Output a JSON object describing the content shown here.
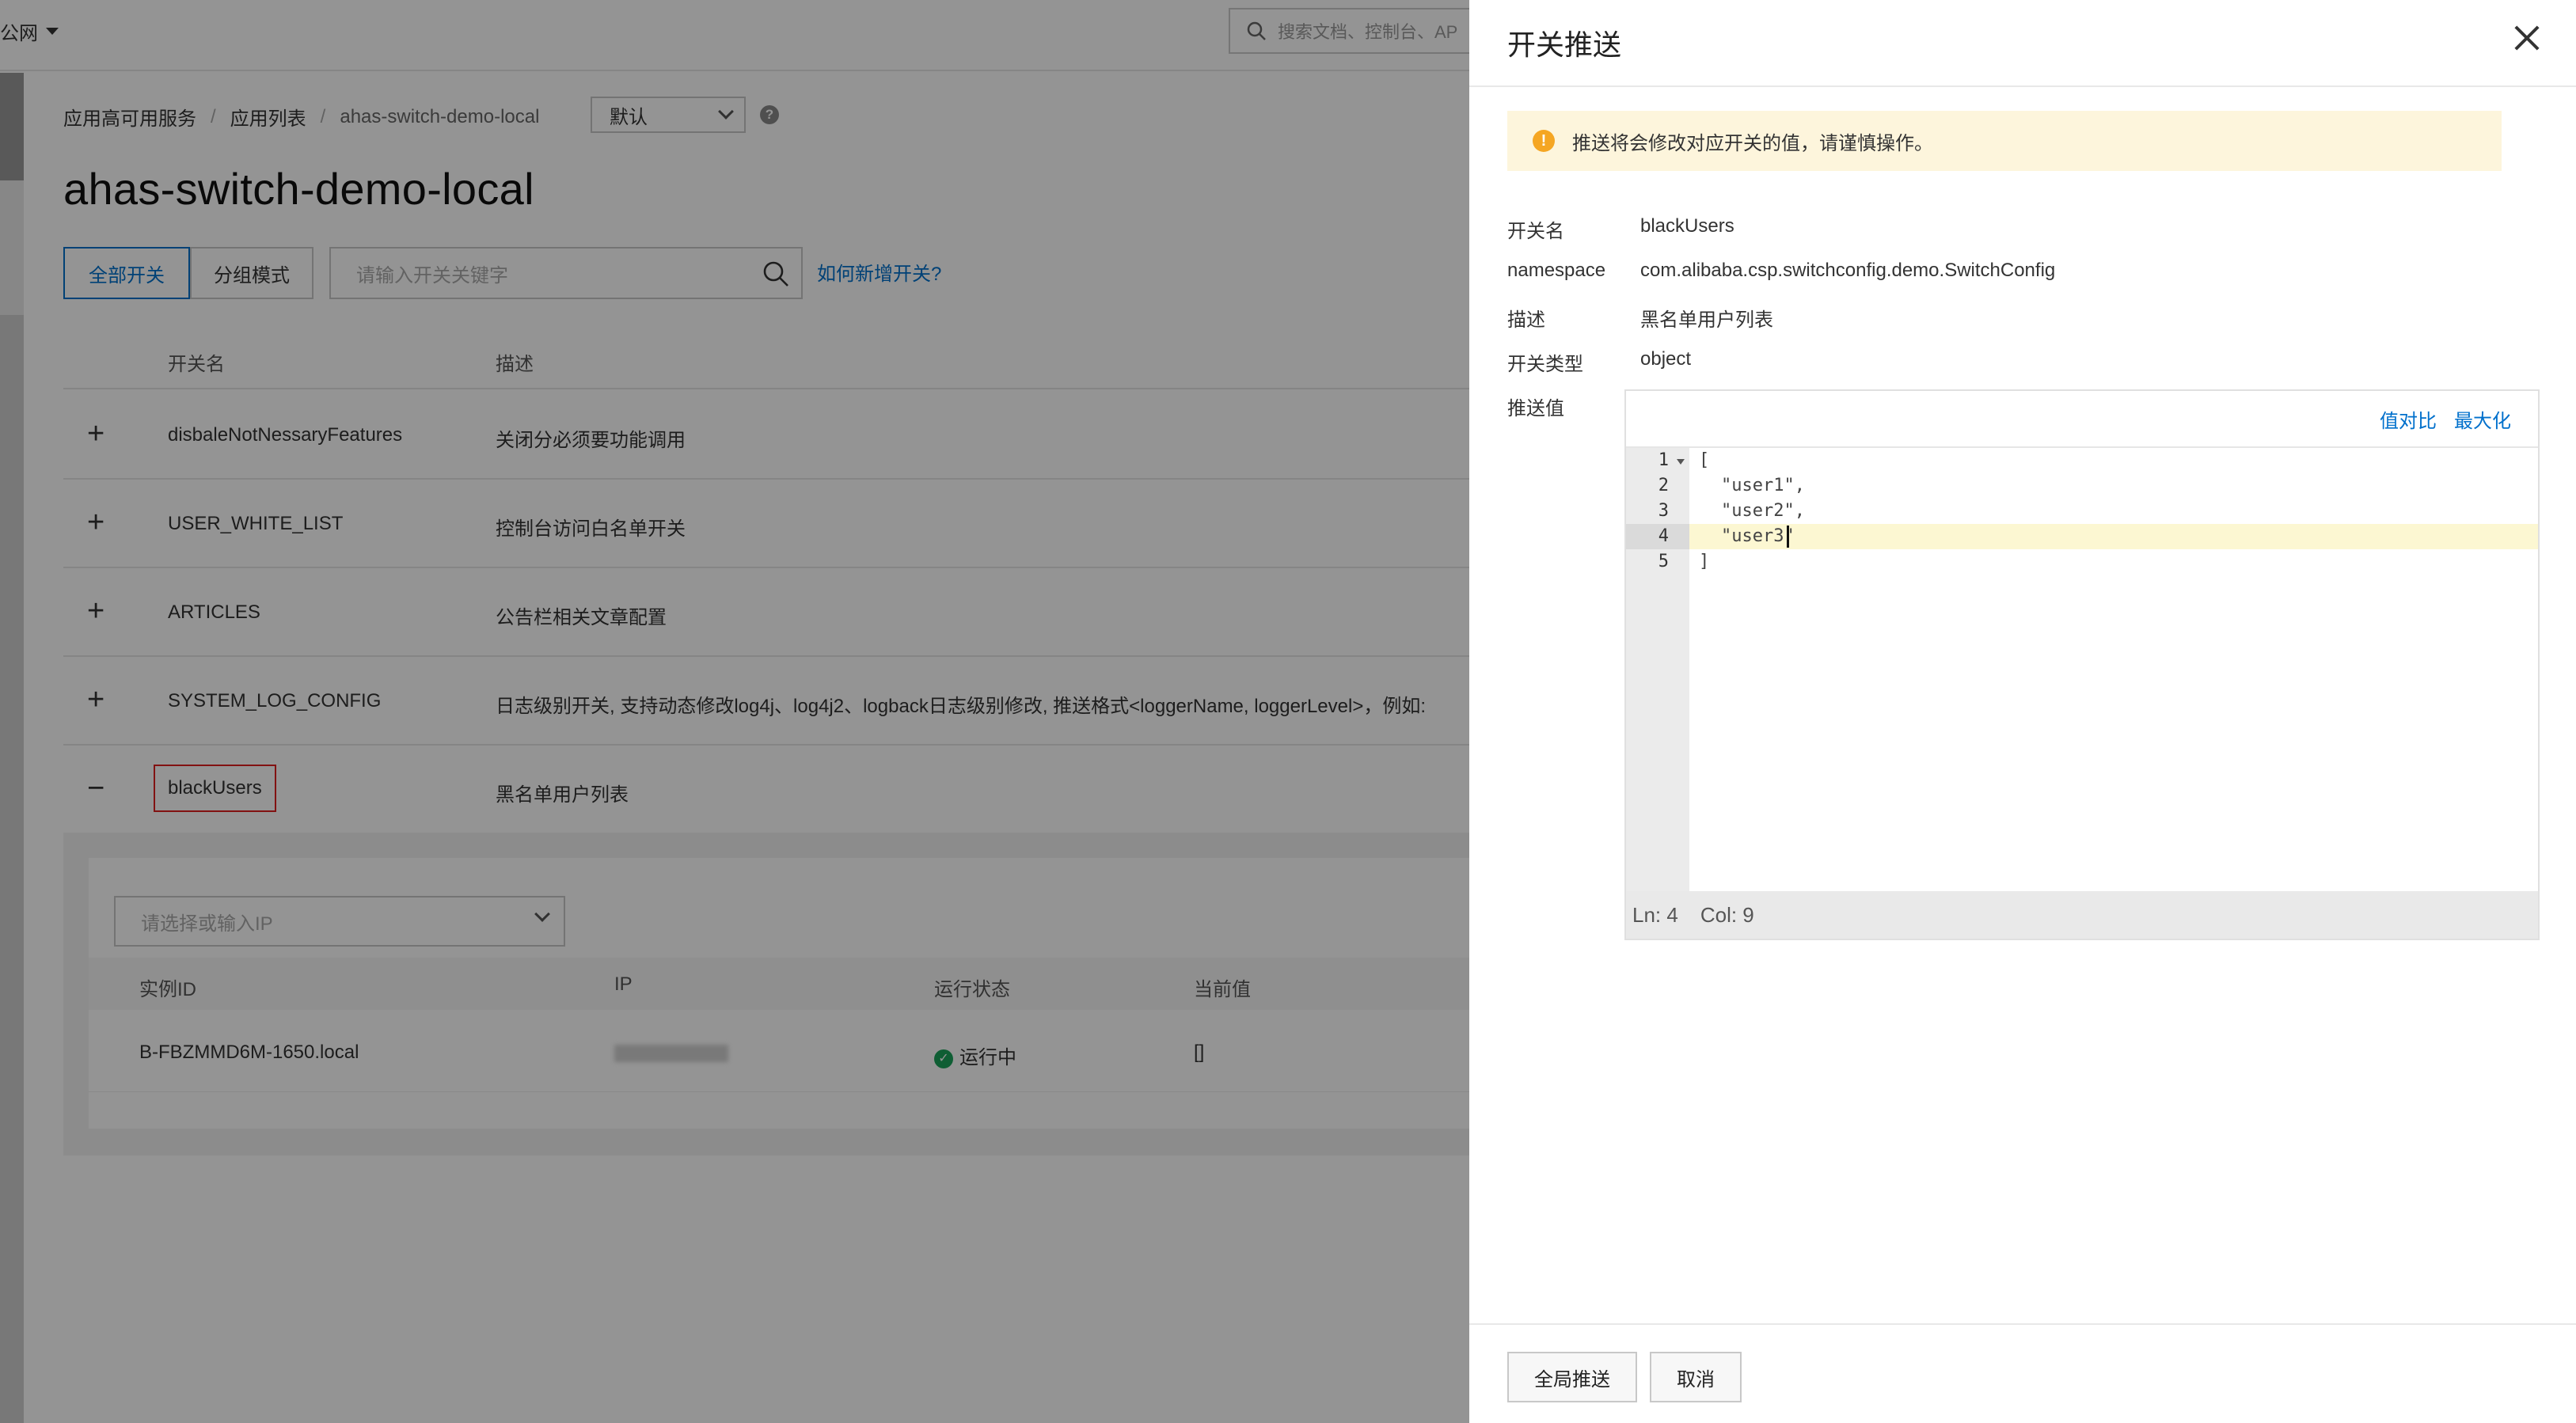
{
  "topbar": {
    "region": "公网",
    "search_placeholder": "搜索文档、控制台、AP"
  },
  "breadcrumb": [
    "应用高可用服务",
    "应用列表",
    "ahas-switch-demo-local"
  ],
  "environment": "默认",
  "page_title": "ahas-switch-demo-local",
  "mode_tabs": {
    "all": "全部开关",
    "group": "分组模式"
  },
  "switch_search_placeholder": "请输入开关关键字",
  "how_to_add": "如何新增开关?",
  "table": {
    "headers": {
      "name": "开关名",
      "desc": "描述"
    },
    "rows": [
      {
        "toggle": "+",
        "name": "disbaleNotNessaryFeatures",
        "desc": "关闭分必须要功能调用"
      },
      {
        "toggle": "+",
        "name": "USER_WHITE_LIST",
        "desc": "控制台访问白名单开关"
      },
      {
        "toggle": "+",
        "name": "ARTICLES",
        "desc": "公告栏相关文章配置"
      },
      {
        "toggle": "+",
        "name": "SYSTEM_LOG_CONFIG",
        "desc": "日志级别开关, 支持动态修改log4j、log4j2、logback日志级别修改, 推送格式<loggerName, loggerLevel>，例如:"
      },
      {
        "toggle": "−",
        "name": "blackUsers",
        "desc": "黑名单用户列表"
      }
    ]
  },
  "expanded": {
    "ip_placeholder": "请选择或输入IP",
    "headers": {
      "instance": "实例ID",
      "ip": "IP",
      "status": "运行状态",
      "value": "当前值"
    },
    "row": {
      "instance": "B-FBZMMD6M-1650.local",
      "status": "运行中",
      "value": "[]"
    }
  },
  "drawer": {
    "title": "开关推送",
    "warning": "推送将会修改对应开关的值，请谨慎操作。",
    "fields": {
      "name_label": "开关名",
      "name_value": "blackUsers",
      "ns_label": "namespace",
      "ns_value": "com.alibaba.csp.switchconfig.demo.SwitchConfig",
      "desc_label": "描述",
      "desc_value": "黑名单用户列表",
      "type_label": "开关类型",
      "type_value": "object",
      "push_label": "推送值"
    },
    "editor": {
      "compare": "值对比",
      "maximize": "最大化",
      "line_numbers": [
        "1",
        "2",
        "3",
        "4",
        "5"
      ],
      "lines": [
        "[",
        "\"user1\",",
        "\"user2\",",
        "\"user3\"",
        "]"
      ],
      "ln": "Ln: 4",
      "col": "Col: 9"
    },
    "footer": {
      "push_all": "全局推送",
      "cancel": "取消"
    }
  },
  "colors": {
    "primary": "#0070cc",
    "warning_bg": "#fdf5dc",
    "warning_icon": "#f5a623",
    "highlight_border": "#e02020",
    "running": "#1aa35a"
  }
}
